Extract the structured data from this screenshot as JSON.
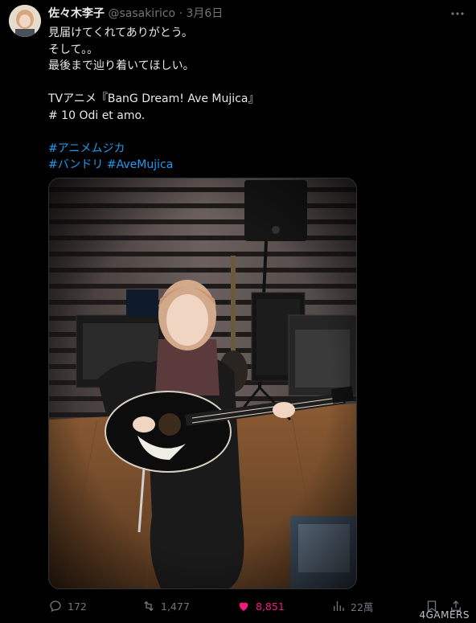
{
  "tweet": {
    "author_name": "佐々木李子",
    "handle": "@sasakirico",
    "separator": "·",
    "date": "3月6日",
    "lines": [
      "見届けてくれてありがとう。",
      "そして。。",
      "最後まで辿り着いてほしい。",
      "",
      "TVアニメ『BanG Dream! Ave Mujica』",
      "# 10 Odi et amo."
    ],
    "hashtags_line1": [
      "#アニメムジカ"
    ],
    "hashtags_line2": [
      "#バンドリ",
      "#AveMujica"
    ]
  },
  "actions": {
    "replies": "172",
    "retweets": "1,477",
    "likes": "8,851",
    "views": "22萬"
  },
  "watermark": "4GAMERS",
  "icons": [
    "more-icon",
    "reply-icon",
    "retweet-icon",
    "heart-icon",
    "views-icon",
    "bookmark-icon",
    "share-icon"
  ],
  "colors": {
    "background": "#000000",
    "text": "#e7e9ea",
    "muted": "#71767b",
    "link": "#1d9bf0",
    "like": "#f91880"
  }
}
